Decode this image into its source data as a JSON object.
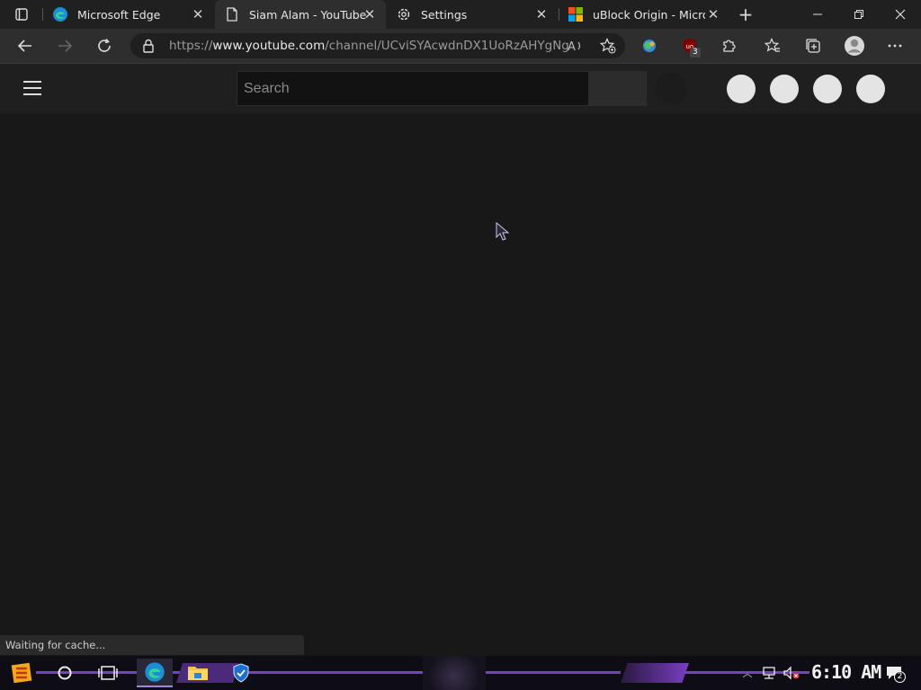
{
  "tabs": [
    {
      "title": "Microsoft Edge",
      "icon": "edge-icon",
      "active": false
    },
    {
      "title": "Siam Alam - YouTube",
      "icon": "youtube-page-icon",
      "active": true
    },
    {
      "title": "Settings",
      "icon": "gear-icon",
      "active": false
    },
    {
      "title": "uBlock Origin - Microso",
      "icon": "microsoft-logo-icon",
      "active": false
    }
  ],
  "address": {
    "prefix": "https://",
    "host": "www.youtube.com",
    "path": "/channel/UCviSYAcwdnDX1UoRzAHYgNg"
  },
  "extensions": {
    "ublock_badge": "3"
  },
  "youtube": {
    "search_placeholder": "Search"
  },
  "status_text": "Waiting for cache...",
  "taskbar": {
    "clock": "6:10 AM",
    "notification_count": "2"
  },
  "colors": {
    "accent_purple": "#7a3fc2",
    "page_bg": "#181818"
  }
}
